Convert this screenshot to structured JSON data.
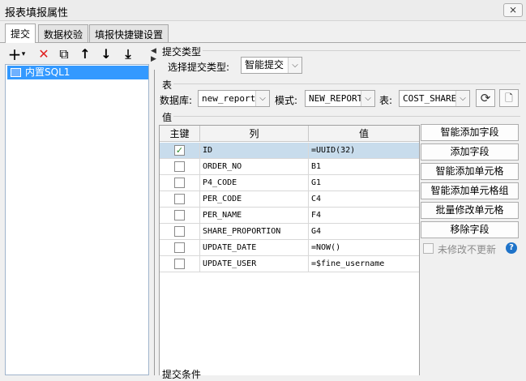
{
  "window": {
    "title": "报表填报属性",
    "close_glyph": "⨯"
  },
  "tabs": [
    {
      "label": "提交",
      "active": true
    },
    {
      "label": "数据校验",
      "active": false
    },
    {
      "label": "填报快捷键设置",
      "active": false
    }
  ],
  "left_toolbar": {
    "add": "+",
    "add_dropdown": "▾",
    "delete": "✕",
    "copy": "⧉",
    "move_up": "↑",
    "move_down": "↓",
    "move_bottom": "⤓"
  },
  "tree": {
    "items": [
      {
        "label": "内置SQL1",
        "selected": true
      }
    ]
  },
  "submit_type_section": {
    "heading": "提交类型",
    "label": "选择提交类型:",
    "value": "智能提交"
  },
  "table_section": {
    "heading": "表",
    "database_label": "数据库:",
    "database_value": "new_report",
    "schema_label": "模式:",
    "schema_value": "NEW_REPORT",
    "table_label": "表:",
    "table_value": "COST_SHARE"
  },
  "value_section": {
    "heading": "值",
    "columns": [
      "主键",
      "列",
      "值"
    ],
    "rows": [
      {
        "key": true,
        "column": "ID",
        "value": "=UUID(32)",
        "selected": true
      },
      {
        "key": false,
        "column": "ORDER_NO",
        "value": "B1"
      },
      {
        "key": false,
        "column": "P4_CODE",
        "value": "G1"
      },
      {
        "key": false,
        "column": "PER_CODE",
        "value": "C4"
      },
      {
        "key": false,
        "column": "PER_NAME",
        "value": "F4"
      },
      {
        "key": false,
        "column": "SHARE_PROPORTION",
        "value": "G4"
      },
      {
        "key": false,
        "column": "UPDATE_DATE",
        "value": "=NOW()"
      },
      {
        "key": false,
        "column": "UPDATE_USER",
        "value": "=$fine_username"
      }
    ]
  },
  "right_buttons": {
    "smart_add_field": "智能添加字段",
    "add_field": "添加字段",
    "smart_add_cell": "智能添加单元格",
    "smart_add_cell_group": "智能添加单元格组",
    "batch_modify_cell": "批量修改单元格",
    "remove_field": "移除字段",
    "no_update_unmodified": "未修改不更新",
    "help": "?"
  },
  "bottom_section": {
    "heading": "提交条件"
  },
  "colors": {
    "selection": "#3399ff",
    "row_selected": "#c8dcec",
    "help": "#1e73c9"
  }
}
